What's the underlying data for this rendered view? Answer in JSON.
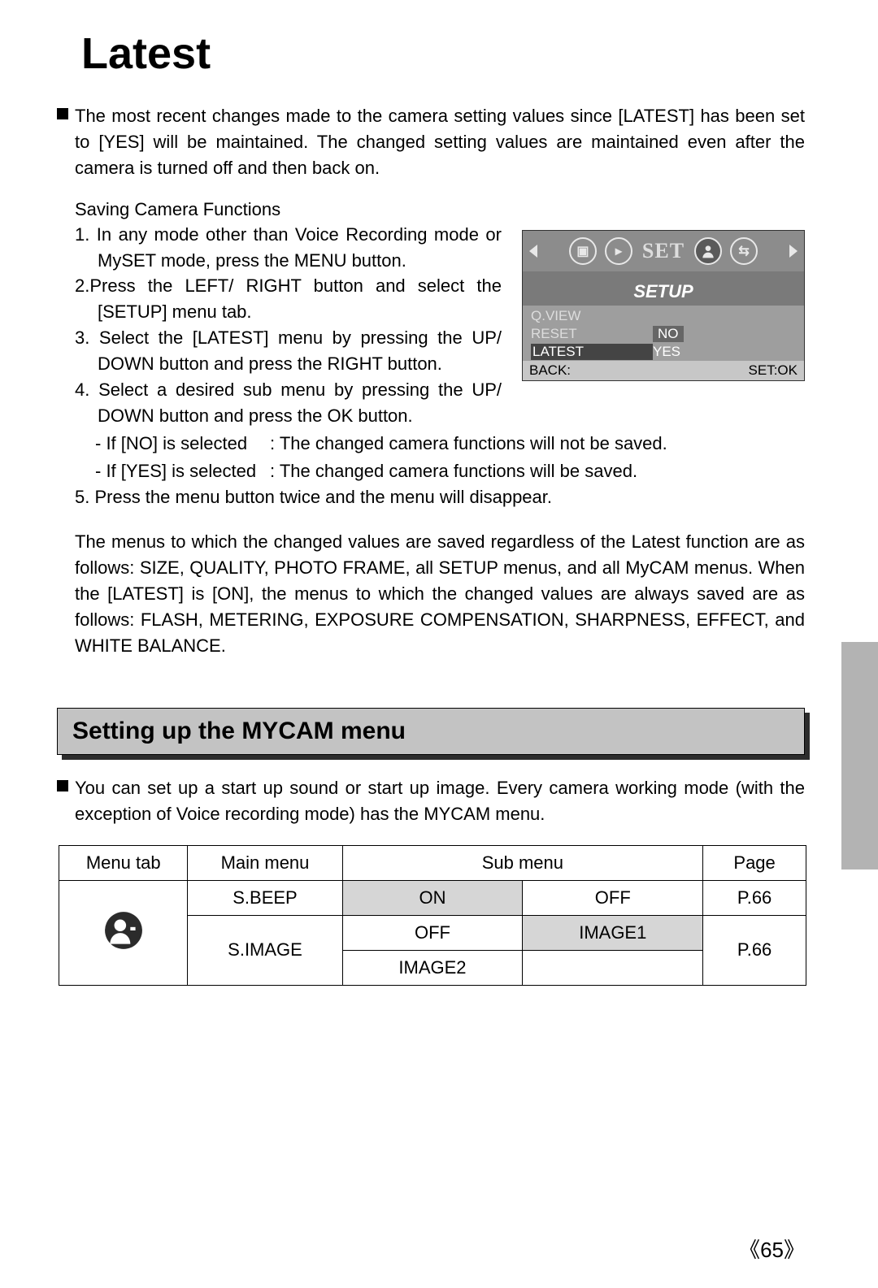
{
  "title": "Latest",
  "intro": "The most recent changes made to the camera setting values since [LATEST] has been set to [YES] will be maintained. The changed setting values are maintained even after the camera is turned off and then back on.",
  "subhead": "Saving Camera Functions",
  "steps": {
    "s1": "1. In any mode other than Voice Recording mode or MySET mode, press the MENU button.",
    "s2": "2.Press the LEFT/ RIGHT button and select the [SETUP] menu tab.",
    "s3": "3. Select the [LATEST] menu by pressing the UP/ DOWN button and press the RIGHT button.",
    "s4": "4. Select a desired sub menu by pressing the UP/ DOWN button and press the OK button.",
    "s4a_k": "- If [NO] is selected",
    "s4a_v": ": The changed camera functions will not be saved.",
    "s4b_k": "- If [YES] is selected",
    "s4b_v": ": The changed camera functions will be saved.",
    "s5": "5. Press the menu button twice and the menu will disappear."
  },
  "cam": {
    "set_label": "SET",
    "title": "SETUP",
    "row1": "Q.VIEW",
    "row2_l": "RESET",
    "row2_r": "NO",
    "row3_l": "LATEST",
    "row3_r": "YES",
    "back": "BACK:",
    "setok": "SET:OK"
  },
  "para": "The menus to which the changed values are saved regardless of the Latest function are as follows: SIZE, QUALITY, PHOTO FRAME, all SETUP menus, and all MyCAM menus. When the [LATEST] is [ON], the menus to which the changed values are always saved are as follows: FLASH, METERING, EXPOSURE COMPENSATION, SHARPNESS, EFFECT, and WHITE BALANCE.",
  "section2": "Setting up the MYCAM menu",
  "intro2": "You can set up a start up sound or start up image. Every camera working mode (with the exception of Voice recording mode) has the MYCAM menu.",
  "table": {
    "h1": "Menu tab",
    "h2": "Main menu",
    "h3": "Sub menu",
    "h4": "Page",
    "r1_main": "S.BEEP",
    "r1_s1": "ON",
    "r1_s2": "OFF",
    "r1_p": "P.66",
    "r2_main": "S.IMAGE",
    "r2_s1": "OFF",
    "r2_s2": "IMAGE1",
    "r2_s3": "IMAGE2",
    "r2_p": "P.66"
  },
  "pagenum": "65"
}
